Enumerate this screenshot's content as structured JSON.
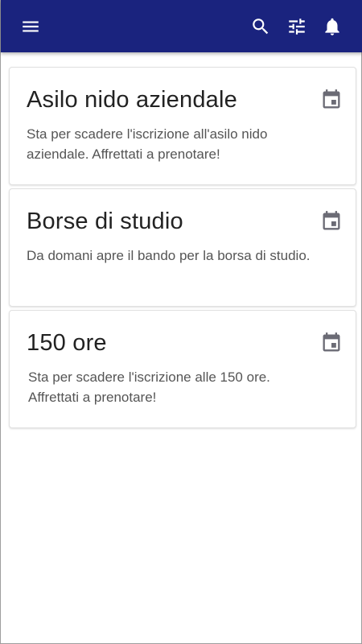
{
  "toolbar": {
    "color": "#1a237e",
    "icons": [
      "menu-icon",
      "search-icon",
      "tune-icon",
      "bell-icon"
    ]
  },
  "cards": [
    {
      "title": "Asilo nido aziendale",
      "text": "Sta per scadere l'iscrizione all'asilo nido aziendale. Affrettati a prenotare!",
      "icon": "calendar-icon"
    },
    {
      "title": "Borse di studio",
      "text": "Da domani apre il bando per la borsa di studio.",
      "icon": "calendar-icon"
    },
    {
      "title": "150 ore",
      "text": "Sta per scadere l'iscrizione alle 150 ore. Affrettati a prenotare!",
      "icon": "calendar-icon"
    }
  ]
}
